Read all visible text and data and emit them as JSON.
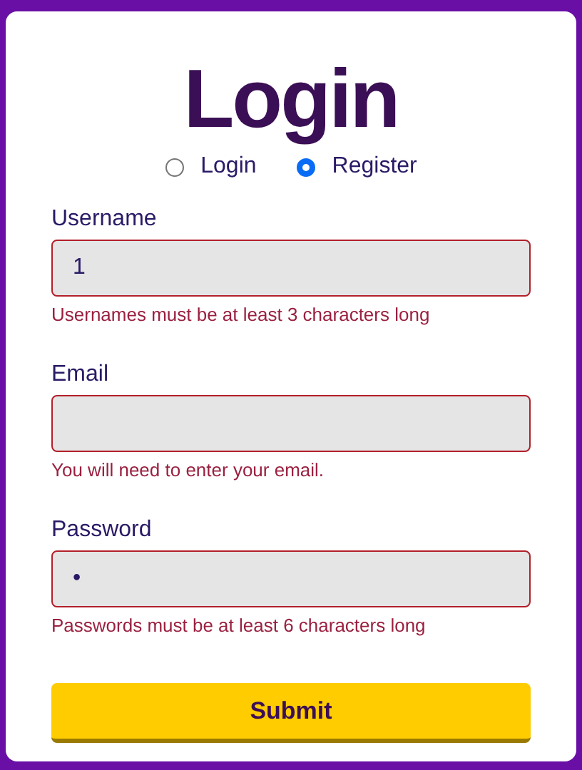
{
  "title": "Login",
  "modes": [
    {
      "label": "Login",
      "selected": false
    },
    {
      "label": "Register",
      "selected": true
    }
  ],
  "fields": [
    {
      "label": "Username",
      "value": "1",
      "invalid": true,
      "error": "Usernames must be at least 3 characters long"
    },
    {
      "label": "Email",
      "invalid": true,
      "error": "You will need to enter your email."
    },
    {
      "label": "Password",
      "value": "•",
      "invalid": true,
      "error": "Passwords must be at least 6 characters long"
    }
  ],
  "submit": "Submit"
}
